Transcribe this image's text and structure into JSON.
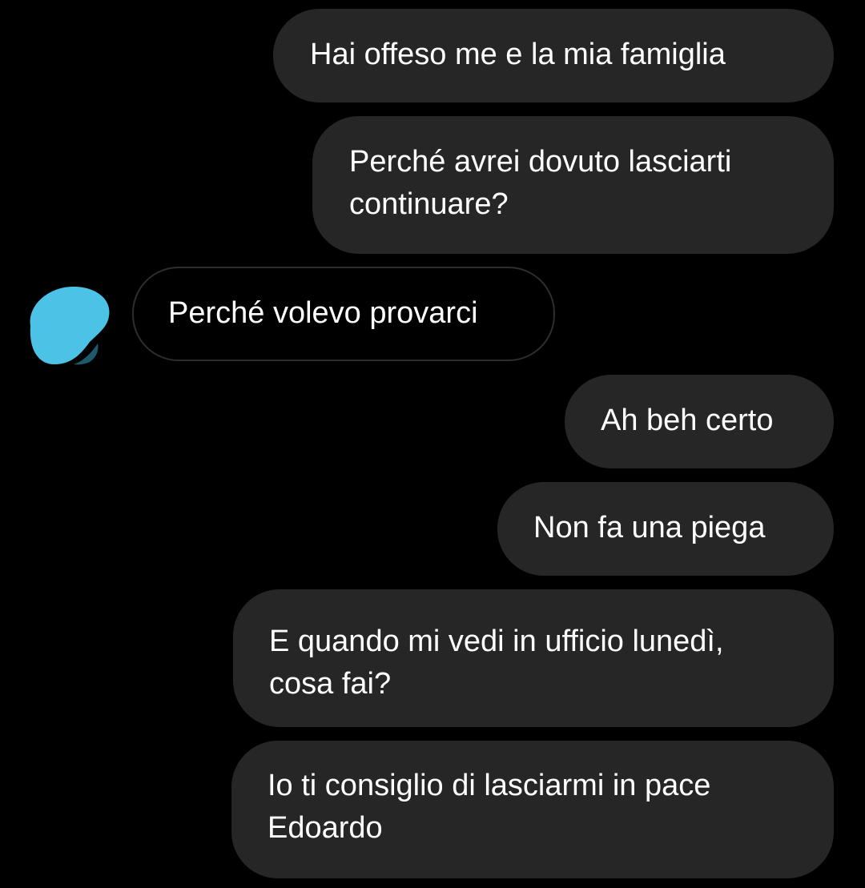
{
  "colors": {
    "background": "#000000",
    "sent_bubble": "#262626",
    "received_border": "#2e2e2e",
    "text": "#ffffff",
    "avatar_fill": "#4cc3e6"
  },
  "messages": [
    {
      "direction": "sent",
      "lines": [
        "Hai offeso me e la mia famiglia"
      ]
    },
    {
      "direction": "sent",
      "lines": [
        "Perché avrei dovuto lasciarti",
        "continuare?"
      ]
    },
    {
      "direction": "received",
      "lines": [
        "Perché volevo provarci"
      ]
    },
    {
      "direction": "sent",
      "lines": [
        "Ah beh certo"
      ]
    },
    {
      "direction": "sent",
      "lines": [
        "Non fa una piega"
      ]
    },
    {
      "direction": "sent",
      "lines": [
        "E quando mi vedi in ufficio lunedì,",
        "cosa fai?"
      ]
    },
    {
      "direction": "sent",
      "lines": [
        "Io ti consiglio di lasciarmi in pace",
        "Edoardo"
      ]
    }
  ],
  "avatar": {
    "icon": "blurred-avatar-icon"
  }
}
